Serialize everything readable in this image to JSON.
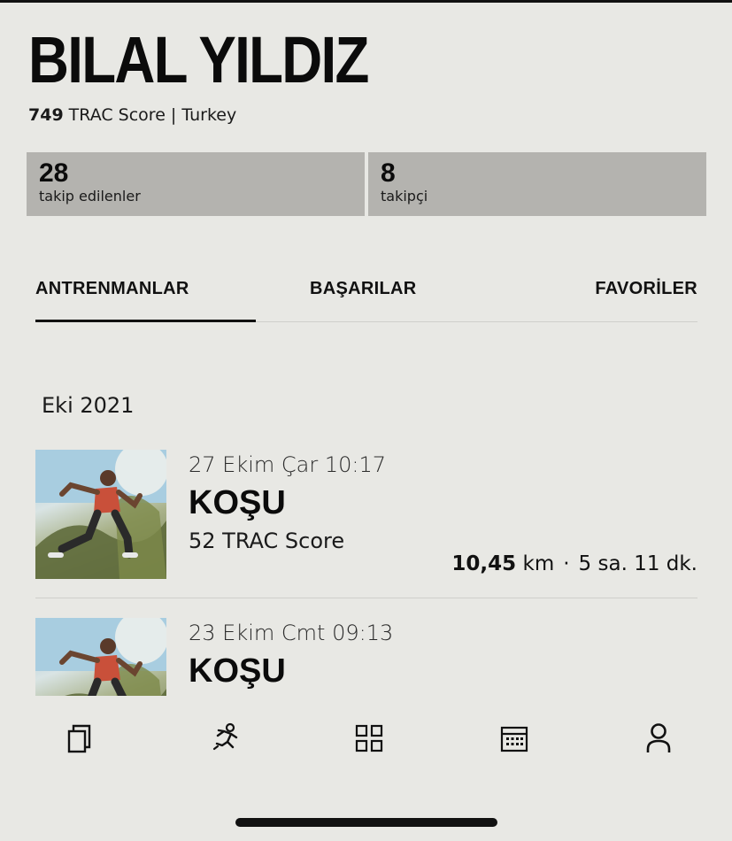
{
  "profile": {
    "name": "BILAL YILDIZ",
    "score": "749",
    "score_text": "TRAC Score | Turkey"
  },
  "stats": {
    "following_count": "28",
    "following_label": "takip edilenler",
    "followers_count": "8",
    "followers_label": "takipçi"
  },
  "tabs": [
    {
      "label": "ANTRENMANLAR",
      "active": true
    },
    {
      "label": "BAŞARILAR",
      "active": false
    },
    {
      "label": "FAVORİLER",
      "active": false
    }
  ],
  "feed": {
    "month": "Eki 2021",
    "activities": [
      {
        "date": "27 Ekim Çar 10:17",
        "type": "KOŞU",
        "score": "52 TRAC Score",
        "distance": "10,45",
        "distance_unit": "km",
        "separator": "·",
        "duration": "5 sa. 11 dk."
      },
      {
        "date": "23 Ekim Cmt 09:13",
        "type": "KOŞU"
      }
    ]
  },
  "nav": {
    "items": [
      {
        "icon": "feed-cards-icon"
      },
      {
        "icon": "runner-icon"
      },
      {
        "icon": "grid-icon"
      },
      {
        "icon": "calendar-icon"
      },
      {
        "icon": "profile-icon"
      }
    ]
  },
  "colors": {
    "background": "#e8e8e4",
    "stat_box": "#b4b3af",
    "text": "#111111"
  }
}
